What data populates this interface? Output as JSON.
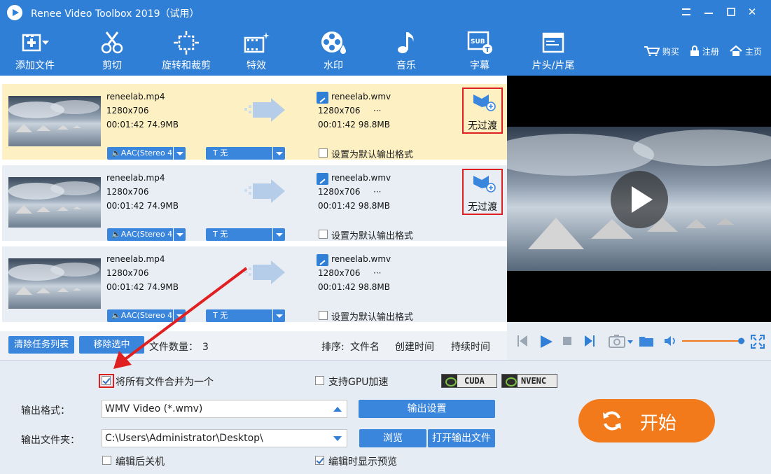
{
  "window": {
    "title": "Renee Video Toolbox 2019（试用）",
    "minimize_icon": "minimize-icon",
    "close_label": "✕"
  },
  "toolbar": {
    "items": [
      {
        "label": "添加文件",
        "icon": "add-file-icon"
      },
      {
        "label": "剪切",
        "icon": "scissors-icon"
      },
      {
        "label": "旋转和裁剪",
        "icon": "rotate-crop-icon"
      },
      {
        "label": "特效",
        "icon": "effects-icon"
      },
      {
        "label": "水印",
        "icon": "watermark-icon"
      },
      {
        "label": "音乐",
        "icon": "music-icon"
      },
      {
        "label": "字幕",
        "icon": "subtitle-icon"
      },
      {
        "label": "片头/片尾",
        "icon": "intro-outro-icon"
      }
    ],
    "links": {
      "buy": "购买",
      "register": "注册",
      "home": "主页"
    }
  },
  "files": [
    {
      "in_name": "reneelab.mp4",
      "in_res": "1280x706",
      "in_info": "00:01:42  74.9MB",
      "out_name": "reneelab.wmv",
      "out_res": "1280x706",
      "out_info": "00:01:42  98.8MB",
      "more": "···",
      "audio": "AAC(Stereo 4",
      "subtitle": "T  无",
      "default_label": "设置为默认输出格式",
      "transition": "无过渡",
      "selected": true
    },
    {
      "in_name": "reneelab.mp4",
      "in_res": "1280x706",
      "in_info": "00:01:42  74.9MB",
      "out_name": "reneelab.wmv",
      "out_res": "1280x706",
      "out_info": "00:01:42  98.8MB",
      "more": "···",
      "audio": "AAC(Stereo 4",
      "subtitle": "T  无",
      "default_label": "设置为默认输出格式",
      "transition": "无过渡",
      "selected": false
    },
    {
      "in_name": "reneelab.mp4",
      "in_res": "1280x706",
      "in_info": "00:01:42  74.9MB",
      "out_name": "reneelab.wmv",
      "out_res": "1280x706",
      "out_info": "00:01:42  98.8MB",
      "more": "···",
      "audio": "AAC(Stereo 4",
      "subtitle": "T  无",
      "default_label": "设置为默认输出格式",
      "transition": "",
      "selected": false
    }
  ],
  "taskbar": {
    "clear_label": "清除任务列表",
    "remove_label": "移除选中",
    "count_label": "文件数量：",
    "count_value": "3",
    "sort_label": "排序:",
    "sort_by_name": "文件名",
    "sort_by_created": "创建时间",
    "sort_by_duration": "持续时间"
  },
  "options": {
    "merge_label": "将所有文件合并为一个",
    "merge_checked": true,
    "gpu_label": "支持GPU加速",
    "gpu_checked": false,
    "cuda_label": "CUDA",
    "nvenc_label": "NVENC",
    "format_label": "输出格式：",
    "format_value": "WMV Video (*.wmv)",
    "output_settings_label": "输出设置",
    "folder_label": "输出文件夹：",
    "folder_value": "C:\\Users\\Administrator\\Desktop\\",
    "browse_label": "浏览",
    "open_folder_label": "打开输出文件",
    "shutdown_label": "编辑后关机",
    "shutdown_checked": false,
    "preview_label": "编辑时显示预览",
    "preview_checked": true,
    "start_label": "开始"
  },
  "colors": {
    "brand_blue": "#2f7fd6",
    "selected_row": "#fdf1c4",
    "start_orange": "#f27a1a",
    "highlight_red": "#e02020"
  },
  "player": {
    "volume_level": 0.96
  }
}
